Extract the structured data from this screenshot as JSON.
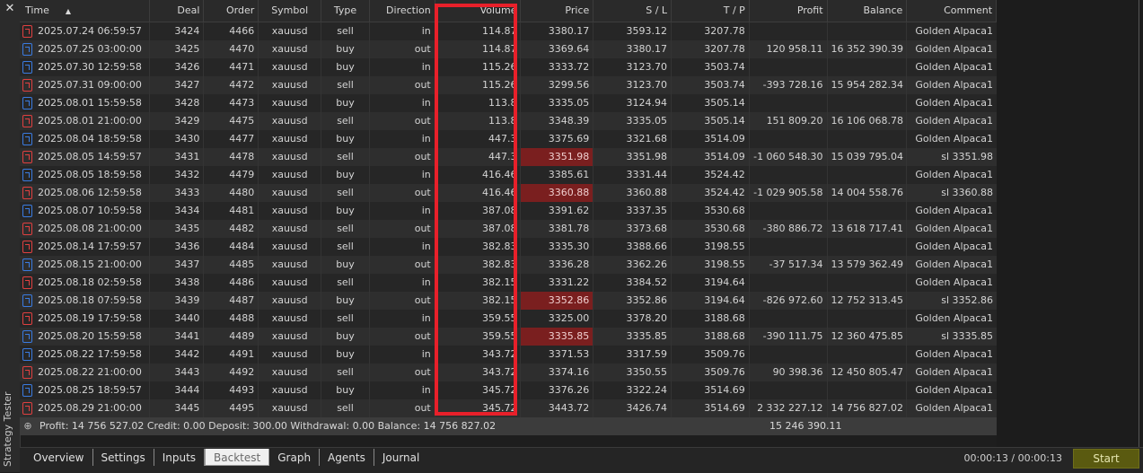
{
  "panel": {
    "side_label": "Strategy Tester",
    "close_glyph": "✕"
  },
  "columns": [
    "Time",
    "Deal",
    "Order",
    "Symbol",
    "Type",
    "Direction",
    "Volume",
    "Price",
    "S / L",
    "T / P",
    "Profit",
    "Balance",
    "Comment"
  ],
  "rows": [
    {
      "time": "2025.07.24 06:59:57",
      "deal": "3424",
      "order": "4466",
      "symbol": "xauusd",
      "type": "sell",
      "direction": "in",
      "volume": "114.87",
      "price": "3380.17",
      "sl": "3593.12",
      "tp": "3207.78",
      "profit": "",
      "balance": "",
      "comment": "Golden Alpaca1",
      "price_hit": false
    },
    {
      "time": "2025.07.25 03:00:00",
      "deal": "3425",
      "order": "4470",
      "symbol": "xauusd",
      "type": "buy",
      "direction": "out",
      "volume": "114.87",
      "price": "3369.64",
      "sl": "3380.17",
      "tp": "3207.78",
      "profit": "120 958.11",
      "balance": "16 352 390.39",
      "comment": "Golden Alpaca1",
      "price_hit": false
    },
    {
      "time": "2025.07.30 12:59:58",
      "deal": "3426",
      "order": "4471",
      "symbol": "xauusd",
      "type": "buy",
      "direction": "in",
      "volume": "115.26",
      "price": "3333.72",
      "sl": "3123.70",
      "tp": "3503.74",
      "profit": "",
      "balance": "",
      "comment": "Golden Alpaca1",
      "price_hit": false
    },
    {
      "time": "2025.07.31 09:00:00",
      "deal": "3427",
      "order": "4472",
      "symbol": "xauusd",
      "type": "sell",
      "direction": "out",
      "volume": "115.26",
      "price": "3299.56",
      "sl": "3123.70",
      "tp": "3503.74",
      "profit": "-393 728.16",
      "balance": "15 954 282.34",
      "comment": "Golden Alpaca1",
      "price_hit": false
    },
    {
      "time": "2025.08.01 15:59:58",
      "deal": "3428",
      "order": "4473",
      "symbol": "xauusd",
      "type": "buy",
      "direction": "in",
      "volume": "113.8",
      "price": "3335.05",
      "sl": "3124.94",
      "tp": "3505.14",
      "profit": "",
      "balance": "",
      "comment": "Golden Alpaca1",
      "price_hit": false
    },
    {
      "time": "2025.08.01 21:00:00",
      "deal": "3429",
      "order": "4475",
      "symbol": "xauusd",
      "type": "sell",
      "direction": "out",
      "volume": "113.8",
      "price": "3348.39",
      "sl": "3335.05",
      "tp": "3505.14",
      "profit": "151 809.20",
      "balance": "16 106 068.78",
      "comment": "Golden Alpaca1",
      "price_hit": false
    },
    {
      "time": "2025.08.04 18:59:58",
      "deal": "3430",
      "order": "4477",
      "symbol": "xauusd",
      "type": "buy",
      "direction": "in",
      "volume": "447.3",
      "price": "3375.69",
      "sl": "3321.68",
      "tp": "3514.09",
      "profit": "",
      "balance": "",
      "comment": "Golden Alpaca1",
      "price_hit": false
    },
    {
      "time": "2025.08.05 14:59:57",
      "deal": "3431",
      "order": "4478",
      "symbol": "xauusd",
      "type": "sell",
      "direction": "out",
      "volume": "447.3",
      "price": "3351.98",
      "sl": "3351.98",
      "tp": "3514.09",
      "profit": "-1 060 548.30",
      "balance": "15 039 795.04",
      "comment": "sl 3351.98",
      "price_hit": true
    },
    {
      "time": "2025.08.05 18:59:58",
      "deal": "3432",
      "order": "4479",
      "symbol": "xauusd",
      "type": "buy",
      "direction": "in",
      "volume": "416.46",
      "price": "3385.61",
      "sl": "3331.44",
      "tp": "3524.42",
      "profit": "",
      "balance": "",
      "comment": "Golden Alpaca1",
      "price_hit": false
    },
    {
      "time": "2025.08.06 12:59:58",
      "deal": "3433",
      "order": "4480",
      "symbol": "xauusd",
      "type": "sell",
      "direction": "out",
      "volume": "416.46",
      "price": "3360.88",
      "sl": "3360.88",
      "tp": "3524.42",
      "profit": "-1 029 905.58",
      "balance": "14 004 558.76",
      "comment": "sl 3360.88",
      "price_hit": true
    },
    {
      "time": "2025.08.07 10:59:58",
      "deal": "3434",
      "order": "4481",
      "symbol": "xauusd",
      "type": "buy",
      "direction": "in",
      "volume": "387.08",
      "price": "3391.62",
      "sl": "3337.35",
      "tp": "3530.68",
      "profit": "",
      "balance": "",
      "comment": "Golden Alpaca1",
      "price_hit": false
    },
    {
      "time": "2025.08.08 21:00:00",
      "deal": "3435",
      "order": "4482",
      "symbol": "xauusd",
      "type": "sell",
      "direction": "out",
      "volume": "387.08",
      "price": "3381.78",
      "sl": "3373.68",
      "tp": "3530.68",
      "profit": "-380 886.72",
      "balance": "13 618 717.41",
      "comment": "Golden Alpaca1",
      "price_hit": false
    },
    {
      "time": "2025.08.14 17:59:57",
      "deal": "3436",
      "order": "4484",
      "symbol": "xauusd",
      "type": "sell",
      "direction": "in",
      "volume": "382.83",
      "price": "3335.30",
      "sl": "3388.66",
      "tp": "3198.55",
      "profit": "",
      "balance": "",
      "comment": "Golden Alpaca1",
      "price_hit": false
    },
    {
      "time": "2025.08.15 21:00:00",
      "deal": "3437",
      "order": "4485",
      "symbol": "xauusd",
      "type": "buy",
      "direction": "out",
      "volume": "382.83",
      "price": "3336.28",
      "sl": "3362.26",
      "tp": "3198.55",
      "profit": "-37 517.34",
      "balance": "13 579 362.49",
      "comment": "Golden Alpaca1",
      "price_hit": false
    },
    {
      "time": "2025.08.18 02:59:58",
      "deal": "3438",
      "order": "4486",
      "symbol": "xauusd",
      "type": "sell",
      "direction": "in",
      "volume": "382.15",
      "price": "3331.22",
      "sl": "3384.52",
      "tp": "3194.64",
      "profit": "",
      "balance": "",
      "comment": "Golden Alpaca1",
      "price_hit": false
    },
    {
      "time": "2025.08.18 07:59:58",
      "deal": "3439",
      "order": "4487",
      "symbol": "xauusd",
      "type": "buy",
      "direction": "out",
      "volume": "382.15",
      "price": "3352.86",
      "sl": "3352.86",
      "tp": "3194.64",
      "profit": "-826 972.60",
      "balance": "12 752 313.45",
      "comment": "sl 3352.86",
      "price_hit": true
    },
    {
      "time": "2025.08.19 17:59:58",
      "deal": "3440",
      "order": "4488",
      "symbol": "xauusd",
      "type": "sell",
      "direction": "in",
      "volume": "359.55",
      "price": "3325.00",
      "sl": "3378.20",
      "tp": "3188.68",
      "profit": "",
      "balance": "",
      "comment": "Golden Alpaca1",
      "price_hit": false
    },
    {
      "time": "2025.08.20 15:59:58",
      "deal": "3441",
      "order": "4489",
      "symbol": "xauusd",
      "type": "buy",
      "direction": "out",
      "volume": "359.55",
      "price": "3335.85",
      "sl": "3335.85",
      "tp": "3188.68",
      "profit": "-390 111.75",
      "balance": "12 360 475.85",
      "comment": "sl 3335.85",
      "price_hit": true
    },
    {
      "time": "2025.08.22 17:59:58",
      "deal": "3442",
      "order": "4491",
      "symbol": "xauusd",
      "type": "buy",
      "direction": "in",
      "volume": "343.72",
      "price": "3371.53",
      "sl": "3317.59",
      "tp": "3509.76",
      "profit": "",
      "balance": "",
      "comment": "Golden Alpaca1",
      "price_hit": false
    },
    {
      "time": "2025.08.22 21:00:00",
      "deal": "3443",
      "order": "4492",
      "symbol": "xauusd",
      "type": "sell",
      "direction": "out",
      "volume": "343.72",
      "price": "3374.16",
      "sl": "3350.55",
      "tp": "3509.76",
      "profit": "90 398.36",
      "balance": "12 450 805.47",
      "comment": "Golden Alpaca1",
      "price_hit": false
    },
    {
      "time": "2025.08.25 18:59:57",
      "deal": "3444",
      "order": "4493",
      "symbol": "xauusd",
      "type": "buy",
      "direction": "in",
      "volume": "345.72",
      "price": "3376.26",
      "sl": "3322.24",
      "tp": "3514.69",
      "profit": "",
      "balance": "",
      "comment": "Golden Alpaca1",
      "price_hit": false
    },
    {
      "time": "2025.08.29 21:00:00",
      "deal": "3445",
      "order": "4495",
      "symbol": "xauusd",
      "type": "sell",
      "direction": "out",
      "volume": "345.72",
      "price": "3443.72",
      "sl": "3426.74",
      "tp": "3514.69",
      "profit": "2 332 227.12",
      "balance": "14 756 827.02",
      "comment": "Golden Alpaca1",
      "price_hit": false
    }
  ],
  "summary": {
    "expand_glyph": "⊕",
    "text": "Profit: 14 756 527.02  Credit: 0.00  Deposit: 300.00  Withdrawal: 0.00  Balance: 14 756 827.02",
    "balance_total": "15 246 390.11"
  },
  "tabs": [
    {
      "label": "Overview",
      "active": false
    },
    {
      "label": "Settings",
      "active": false
    },
    {
      "label": "Inputs",
      "active": false
    },
    {
      "label": "Backtest",
      "active": true
    },
    {
      "label": "Graph",
      "active": false
    },
    {
      "label": "Agents",
      "active": false
    },
    {
      "label": "Journal",
      "active": false
    }
  ],
  "timer": "00:00:13 / 00:00:13",
  "start_label": "Start",
  "colors": {
    "sell_icon": "#e04040",
    "buy_icon": "#3a7be0",
    "highlight_box": "#e8202a",
    "price_hit_bg": "#7a1f1f",
    "start_bg": "#5a5a10"
  }
}
